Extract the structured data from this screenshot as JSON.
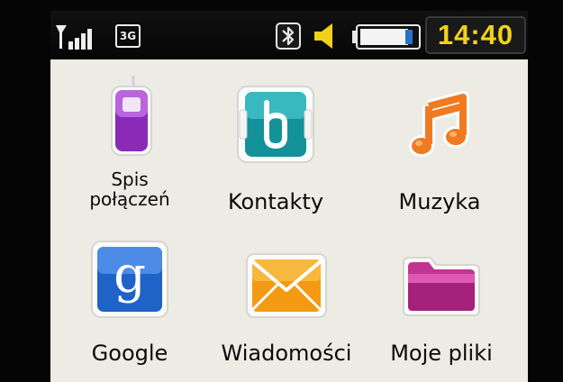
{
  "status_bar": {
    "network_type": "3G",
    "time": "14:40",
    "signal_icon": "signal-strength-icon",
    "bluetooth_icon": "bluetooth-icon",
    "volume_icon": "speaker-icon",
    "battery_icon": "battery-icon",
    "battery_level": 0.85
  },
  "menu": {
    "items": [
      {
        "label_line1": "Spis",
        "label_line2": "połączeń",
        "icon": "call-log-icon"
      },
      {
        "label": "Kontakty",
        "icon": "contacts-icon"
      },
      {
        "label": "Muzyka",
        "icon": "music-note-icon"
      },
      {
        "label": "Google",
        "icon": "google-icon"
      },
      {
        "label": "Wiadomości",
        "icon": "envelope-icon"
      },
      {
        "label": "Moje pliki",
        "icon": "folder-icon"
      }
    ]
  },
  "colors": {
    "screen_background": "#ecebe4",
    "status_bar_background": "#0a0a0a",
    "clock_text": "#f1d21a",
    "call_log_purple": "#8a2bb8",
    "contacts_teal": "#13929a",
    "music_orange": "#f07a22",
    "google_blue": "#1f62c8",
    "messages_orange": "#f39a12",
    "folder_magenta": "#c23494"
  }
}
